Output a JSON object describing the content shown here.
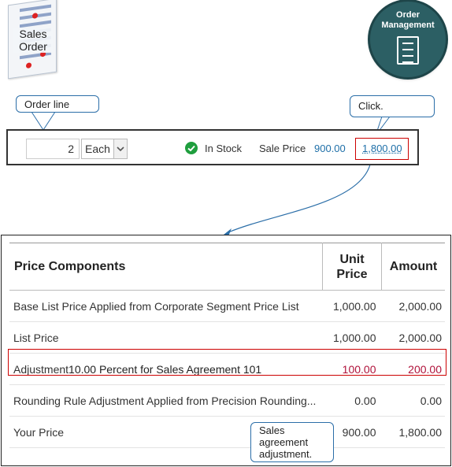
{
  "icons": {
    "sales_order_label": "Sales Order",
    "order_management_label": "Order Management"
  },
  "callouts": {
    "order_line": "Order  line",
    "click": "Click.",
    "sales_agreement": "Sales agreement adjustment."
  },
  "order_line": {
    "quantity": "2",
    "uom": "Each",
    "stock_status": "In Stock",
    "sale_price_label": "Sale Price",
    "sale_price_value": "900.00",
    "total_value": "1,800.00"
  },
  "price_table": {
    "headers": {
      "component": "Price Components",
      "unit_price": "Unit Price",
      "amount": "Amount"
    },
    "rows": [
      {
        "component": "Base List Price Applied from Corporate Segment Price List",
        "unit_price": "1,000.00",
        "amount": "2,000.00"
      },
      {
        "component": "List Price",
        "unit_price": "1,000.00",
        "amount": "2,000.00"
      },
      {
        "component": "Adjustment",
        "component_detail": "10.00 Percent for Sales Agreement 101",
        "unit_price": "100.00",
        "amount": "200.00"
      },
      {
        "component": "Rounding Rule Adjustment Applied from Precision Rounding...",
        "unit_price": "0.00",
        "amount": "0.00"
      },
      {
        "component": "Your Price",
        "unit_price": "900.00",
        "amount": "1,800.00"
      }
    ]
  },
  "colors": {
    "link": "#1e6fa8",
    "highlight": "#cc0000",
    "adjustment_value": "#b0123a",
    "om_circle": "#2c5f64",
    "in_stock": "#1f9e3e"
  }
}
